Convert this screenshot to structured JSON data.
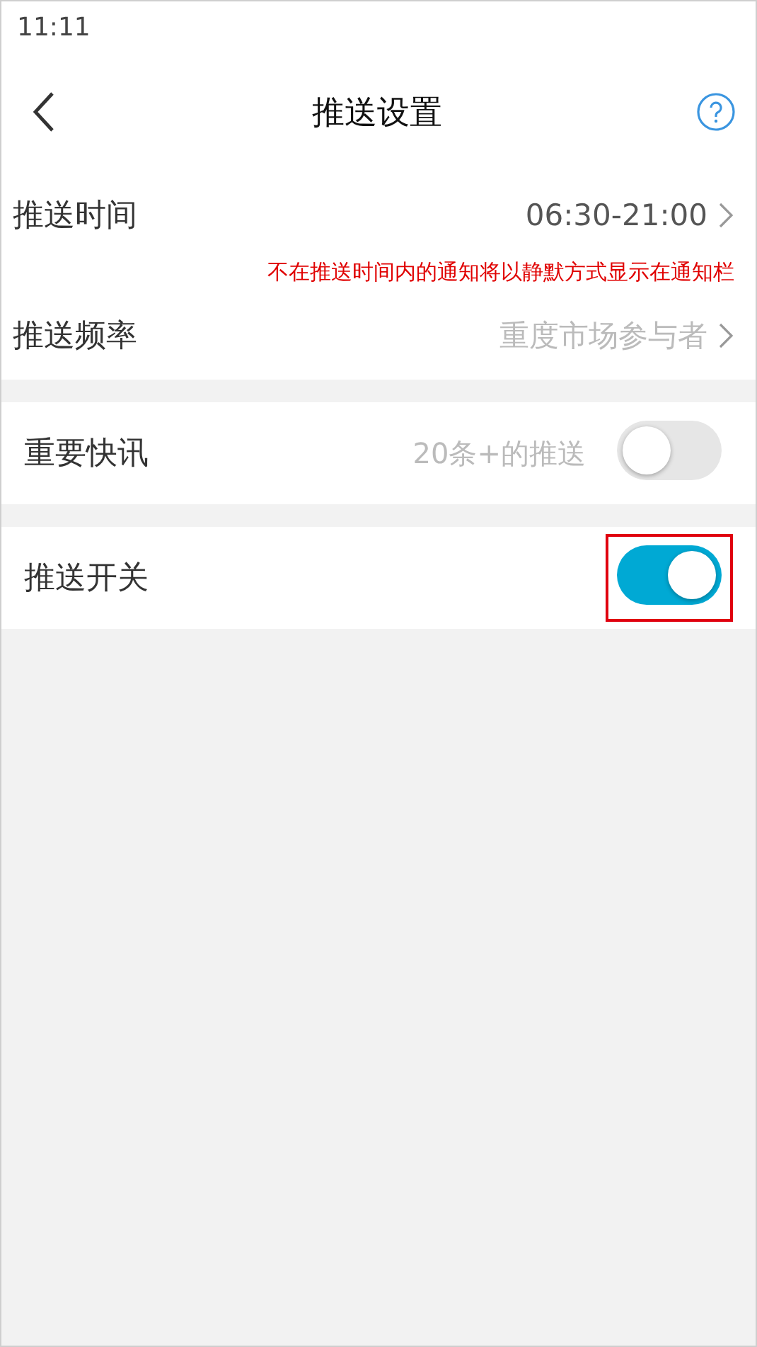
{
  "status_bar": {
    "time": "11:11"
  },
  "header": {
    "title": "推送设置"
  },
  "sections": [
    {
      "items": [
        {
          "kind": "link",
          "label": "推送时间",
          "value": "06:30-21:00",
          "muted": false,
          "note": "不在推送时间内的通知将以静默方式显示在通知栏"
        },
        {
          "kind": "link",
          "label": "推送频率",
          "value": "重度市场参与者",
          "muted": true
        }
      ]
    },
    {
      "items": [
        {
          "kind": "toggle",
          "label": "重要快讯",
          "value": "20条+的推送",
          "on": false
        }
      ]
    },
    {
      "items": [
        {
          "kind": "toggle",
          "label": "推送开关",
          "on": true,
          "highlighted": true
        }
      ]
    }
  ]
}
